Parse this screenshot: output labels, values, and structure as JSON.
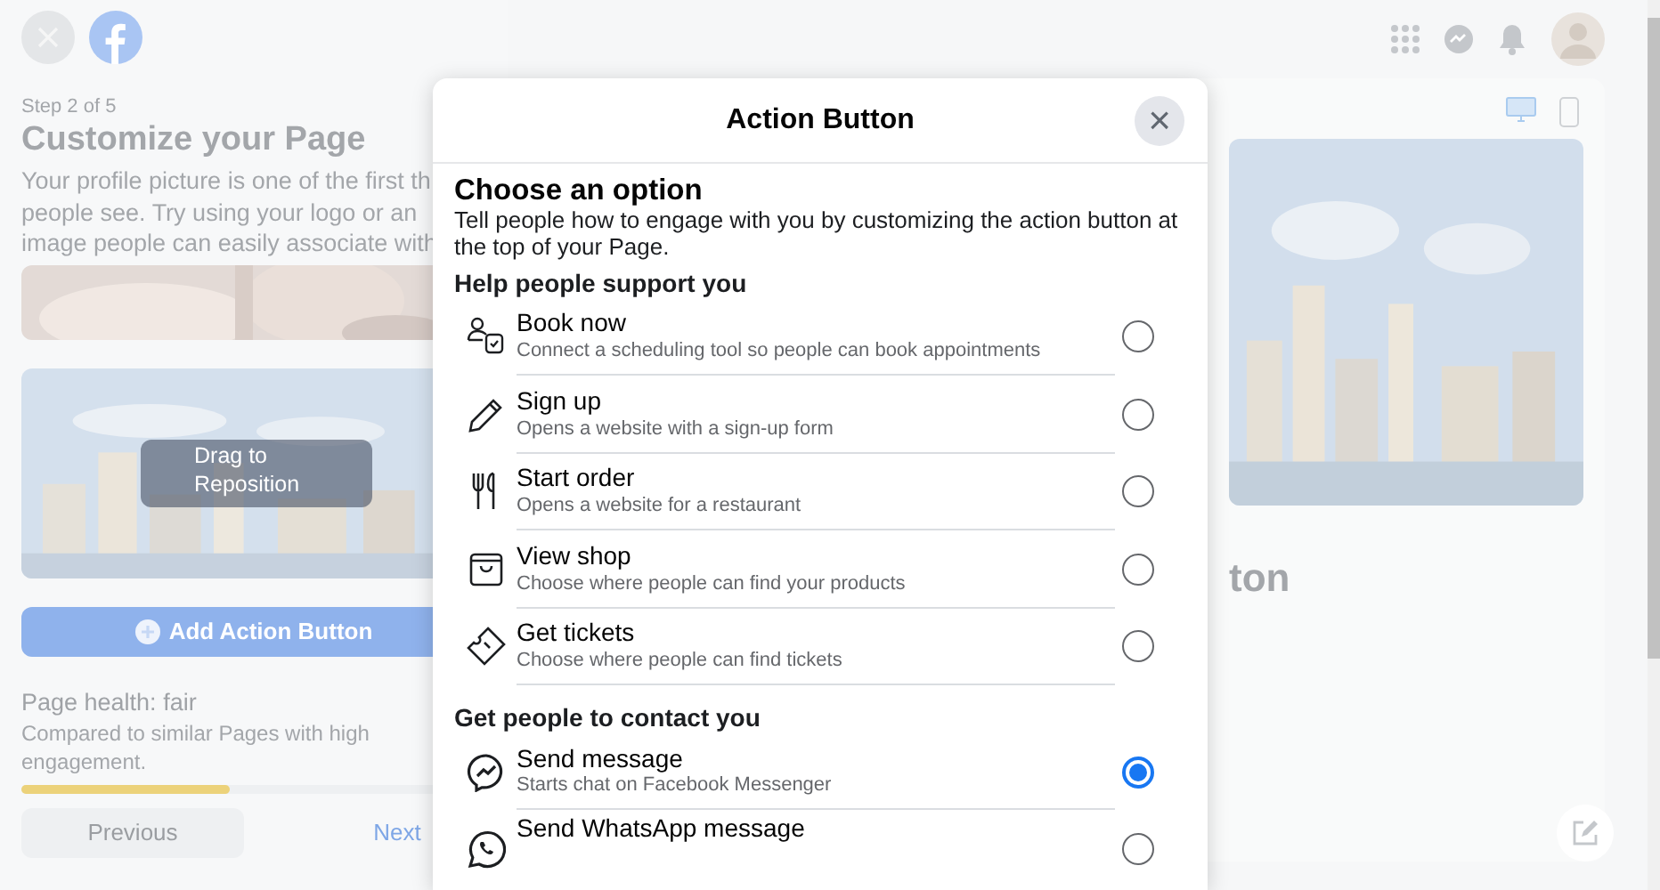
{
  "background": {
    "step": "Step 2 of 5",
    "title": "Customize your Page",
    "description_lines": [
      "Your profile picture is one of the first th",
      "people see. Try using your logo or an",
      "image people can easily associate with"
    ],
    "drag_hint": "Drag to Reposition",
    "add_button": "Add Action Button",
    "health_title": "Page health: fair",
    "health_text": "Compared to similar Pages with high engagement.",
    "health": {
      "level": 0.45
    },
    "previous": "Previous",
    "next": "Next",
    "preview_heading": "ton"
  },
  "modal": {
    "title": "Action Button",
    "close": "×",
    "heading": "Choose an option",
    "description": "Tell people how to engage with you by customizing the action button at the top of your Page.",
    "sections": [
      {
        "title": "Help people support you",
        "options": [
          {
            "kind": "book",
            "label": "Book now",
            "detail": "Connect a scheduling tool so people can book appointments",
            "selected": false
          },
          {
            "kind": "signup",
            "label": "Sign up",
            "detail": "Opens a website with a sign-up form",
            "selected": false
          },
          {
            "kind": "order",
            "label": "Start order",
            "detail": "Opens a website for a restaurant",
            "selected": false
          },
          {
            "kind": "shop",
            "label": "View shop",
            "detail": "Choose where people can find your products",
            "selected": false
          },
          {
            "kind": "tickets",
            "label": "Get tickets",
            "detail": "Choose where people can find tickets",
            "selected": false
          }
        ]
      },
      {
        "title": "Get people to contact you",
        "options": [
          {
            "kind": "messenger",
            "label": "Send message",
            "detail": "Starts chat on Facebook Messenger",
            "selected": true
          },
          {
            "kind": "whatsapp",
            "label": "Send WhatsApp message",
            "selected": false
          }
        ]
      }
    ]
  }
}
